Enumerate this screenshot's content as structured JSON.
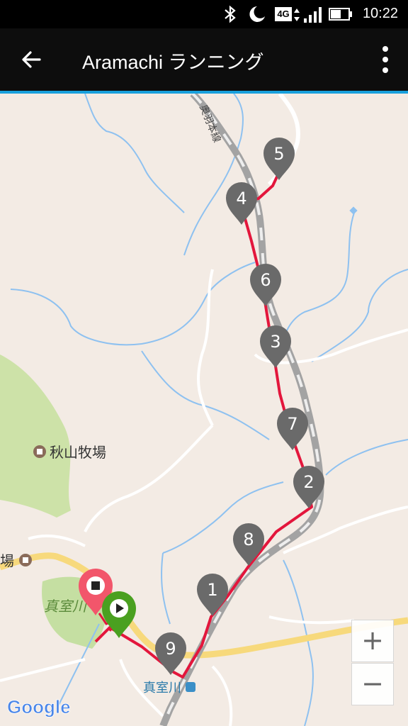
{
  "status_bar": {
    "time": "10:22",
    "network_label": "4G",
    "icons": [
      "bluetooth-icon",
      "moon-icon",
      "network-4g-icon",
      "signal-icon",
      "battery-icon"
    ]
  },
  "app_bar": {
    "title": "Aramachi ランニング",
    "back_icon": "arrow-left-icon",
    "menu_icon": "more-vert-icon",
    "accent_color": "#19a0dc"
  },
  "map": {
    "labels": {
      "railway": "奥羽本線",
      "ranch": "秋山牧場",
      "ranch_cut": "場",
      "area": "真室川",
      "station": "真室川"
    },
    "markers": [
      {
        "label": "5"
      },
      {
        "label": "4"
      },
      {
        "label": "6"
      },
      {
        "label": "3"
      },
      {
        "label": "7"
      },
      {
        "label": "2"
      },
      {
        "label": "8"
      },
      {
        "label": "1"
      },
      {
        "label": "9"
      }
    ],
    "start_marker": "play-icon",
    "end_marker": "stop-icon",
    "route_color": "#e3163c",
    "attribution": "Google"
  },
  "zoom": {
    "in_label": "+",
    "out_label": "−"
  }
}
